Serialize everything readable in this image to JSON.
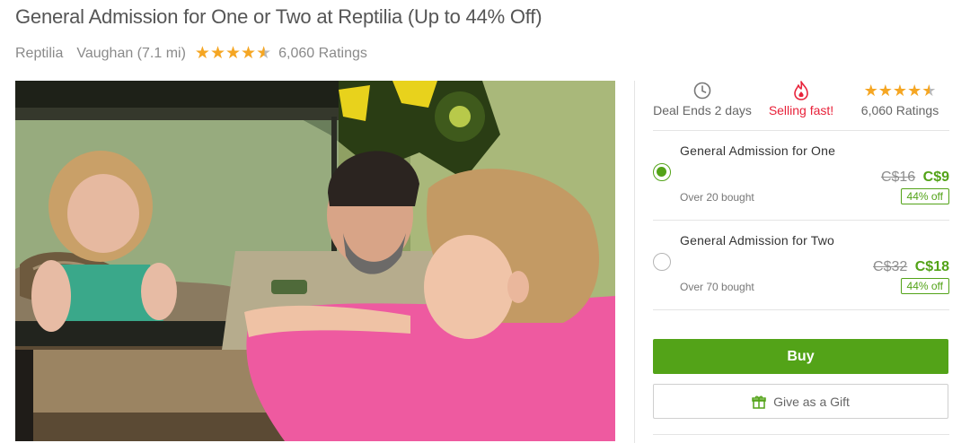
{
  "deal": {
    "title": "General Admission for One or Two at Reptilia (Up to 44% Off)",
    "merchant": "Reptilia",
    "location": "Vaughan (7.1 mi)",
    "rating": 4.5,
    "ratings_count": "6,060 Ratings"
  },
  "photo": {
    "icon": "deal-photo"
  },
  "info_bar": {
    "deal_ends": "Deal Ends 2 days",
    "selling_fast": "Selling fast!",
    "ratings": "6,060 Ratings",
    "colors": {
      "fast": "#e8223a",
      "star": "#f5a623"
    }
  },
  "options": [
    {
      "title": "General Admission for One",
      "original_price": "C$16",
      "price": "C$9",
      "bought": "Over 20 bought",
      "discount": "44% off",
      "selected": true
    },
    {
      "title": "General Admission for Two",
      "original_price": "C$32",
      "price": "C$18",
      "bought": "Over 70 bought",
      "discount": "44% off",
      "selected": false
    }
  ],
  "actions": {
    "buy_label": "Buy",
    "gift_label": "Give as a Gift"
  },
  "theme": {
    "accent": "#53a318",
    "title_color": "#555555",
    "muted": "#8a8a8a"
  }
}
